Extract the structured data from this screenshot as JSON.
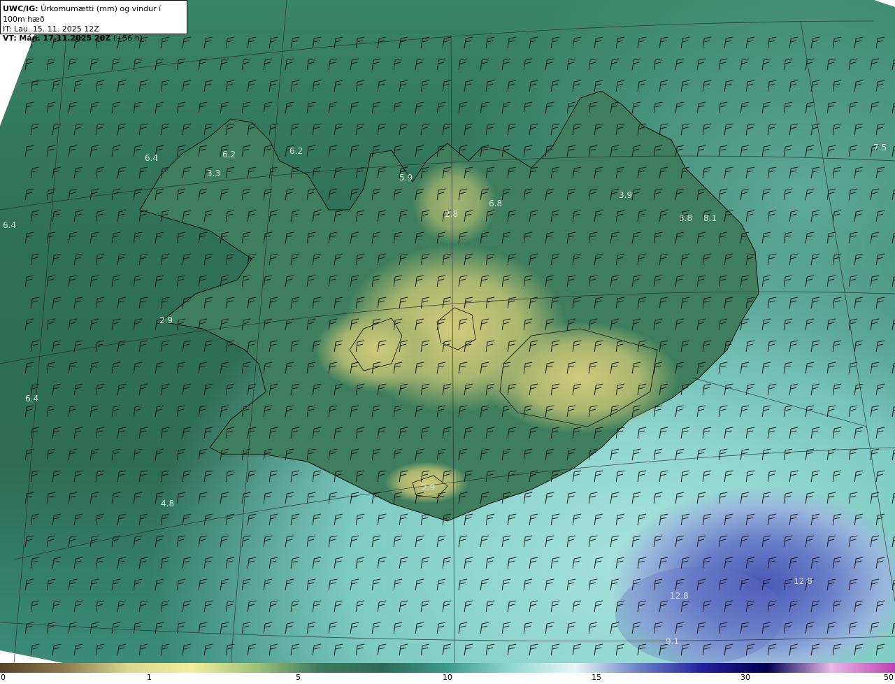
{
  "header": {
    "model": "UWC/IG:",
    "title": "Úrkomumætti (mm) og vindur í 100m hæð",
    "it_label": "IT:",
    "it_value": "Lau. 15. 11. 2025 12Z",
    "vt_label": "VT:",
    "vt_value": "Mán. 17.11.2025 20Z",
    "vt_offset": "(+56 h)"
  },
  "labels": [
    "6.4",
    "6.2",
    "6.2",
    "3.3",
    "5.9",
    "2.8",
    "6.8",
    "3.9",
    "3.8",
    "8.1",
    "7.5",
    "6.4",
    "2.9",
    "6.4",
    "4.8",
    "2.9",
    "12.8",
    "12.8",
    "9.1"
  ],
  "colorbar": {
    "ticks": [
      "0",
      "1",
      "5",
      "10",
      "15",
      "30",
      "50"
    ],
    "stops": [
      "#5a4226",
      "#8c7a4e",
      "#d8d890",
      "#f3ee9a",
      "#9fc27a",
      "#3c7a5e",
      "#2e6a58",
      "#3e9a8a",
      "#90d8d0",
      "#e8f6f6",
      "#6a80c8",
      "#20209a",
      "#000050",
      "#e8b8e8",
      "#c040b0"
    ]
  },
  "colors": {
    "land_dark": "#2f6e56",
    "land_high": "#c9c77a",
    "sea_west": "#2e6c55",
    "sea_south": "#8fd6cf",
    "low_center": "#5c68c2"
  }
}
